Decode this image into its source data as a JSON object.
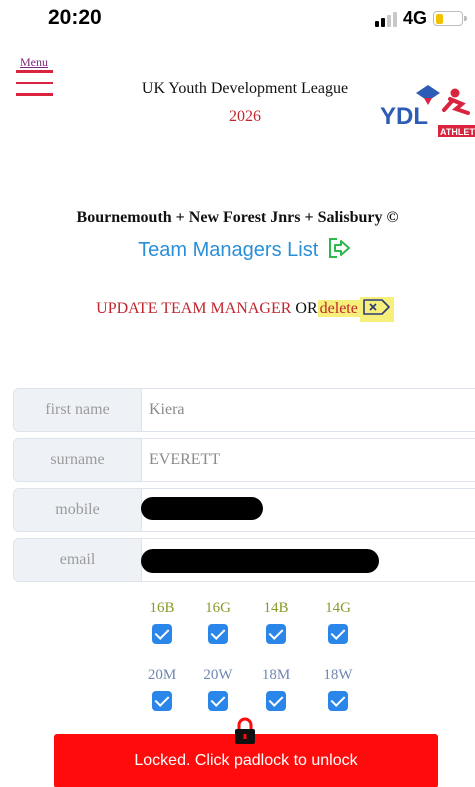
{
  "status_bar": {
    "time": "20:20",
    "network": "4G"
  },
  "header": {
    "menu_label": "Menu",
    "league_title": "UK Youth Development League",
    "year": "2026",
    "logo_text": "YDL",
    "logo_subtext": "ATHLETICS"
  },
  "club": {
    "name": "Bournemouth + New Forest Jnrs + Salisbury ©"
  },
  "team_managers_link": "Team Managers List",
  "update": {
    "label": "UPDATE TEAM MANAGER",
    "or": "OR",
    "delete": "delete"
  },
  "form": {
    "first_name": {
      "label": "first name",
      "value": "Kiera"
    },
    "surname": {
      "label": "surname",
      "value": "EVERETT"
    },
    "mobile": {
      "label": "mobile",
      "value": ""
    },
    "email": {
      "label": "email",
      "value": ""
    }
  },
  "age_groups_row1": [
    {
      "label": "16B",
      "checked": true
    },
    {
      "label": "16G",
      "checked": true
    },
    {
      "label": "14B",
      "checked": true
    },
    {
      "label": "14G",
      "checked": true
    }
  ],
  "age_groups_row2": [
    {
      "label": "20M",
      "checked": true
    },
    {
      "label": "20W",
      "checked": true
    },
    {
      "label": "18M",
      "checked": true
    },
    {
      "label": "18W",
      "checked": true
    }
  ],
  "lock_message": "Locked. Click padlock to unlock",
  "colors": {
    "red": "#c0262d",
    "link_blue": "#2b8fd8",
    "checkbox_blue": "#2a86e8",
    "lock_bar": "#ff0b0b",
    "highlight": "#f6f07a"
  }
}
